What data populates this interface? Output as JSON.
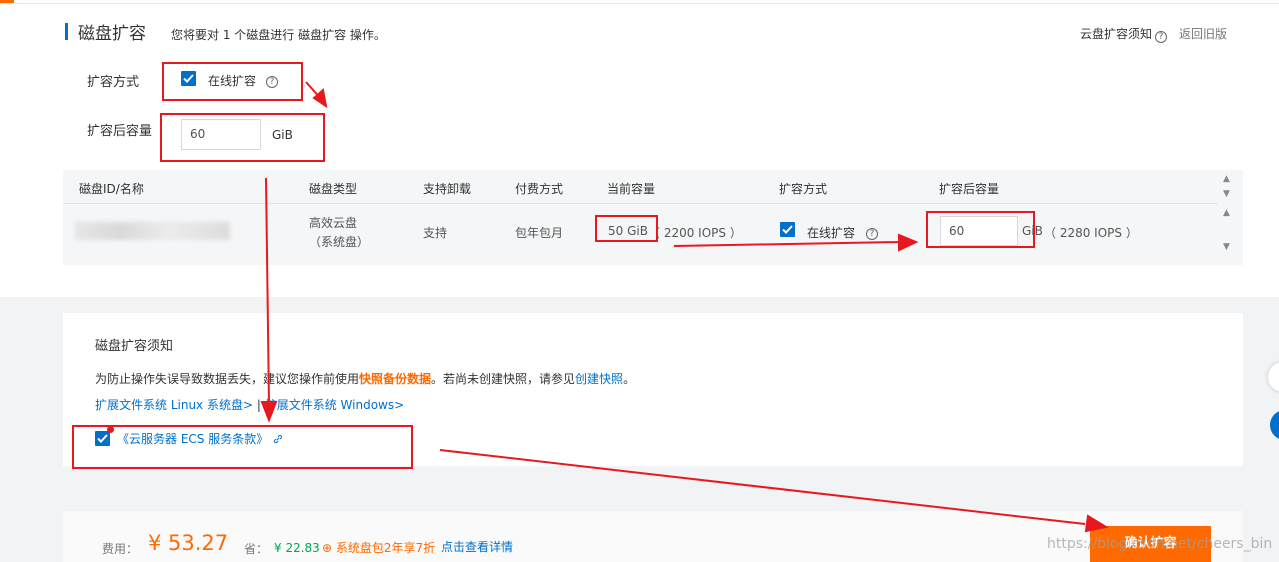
{
  "header": {
    "title": "磁盘扩容",
    "subtitle": "您将要对 1 个磁盘进行 磁盘扩容 操作。",
    "notice_link": "云盘扩容须知",
    "old_version_link": "返回旧版"
  },
  "form": {
    "method_label": "扩容方式",
    "method_option": "在线扩容",
    "capacity_label": "扩容后容量",
    "capacity_value": "60",
    "capacity_unit": "GiB"
  },
  "table": {
    "columns": [
      "磁盘ID/名称",
      "磁盘类型",
      "支持卸载",
      "付费方式",
      "当前容量",
      "扩容方式",
      "扩容后容量"
    ],
    "row": {
      "type_line1": "高效云盘",
      "type_line2": "（系统盘）",
      "detachable": "支持",
      "billing": "包年包月",
      "current_capacity": "50 GiB",
      "current_iops": "（ 2200 IOPS ）",
      "method": "在线扩容",
      "new_capacity": "60",
      "new_unit": "GiB",
      "new_iops": "（ 2280 IOPS ）"
    }
  },
  "notice": {
    "title": "磁盘扩容须知",
    "text_prefix": "为防止操作失误导致数据丢失，建议您操作前使用",
    "text_backup": "快照备份数据",
    "text_middle": "。若尚未创建快照，请参见",
    "text_snapshot": "创建快照",
    "text_suffix": "。",
    "link_linux": "扩展文件系统 Linux 系统盘>",
    "link_sep": "|",
    "link_windows": "扩展文件系统 Windows>",
    "tos": "《云服务器 ECS 服务条款》"
  },
  "footer": {
    "fee_label": "费用：",
    "fee_value": "¥ 53.27",
    "save_label": "省：",
    "save_value": "¥ 22.83",
    "promo": "系统盘包2年享7折",
    "detail_link": "点击查看详情",
    "confirm": "确认扩容"
  },
  "watermark": "https://blog.csdn.net/cheers_bin",
  "colors": {
    "accent": "#ff6a00",
    "primary": "#0070cc",
    "annotation": "#e8191e"
  }
}
